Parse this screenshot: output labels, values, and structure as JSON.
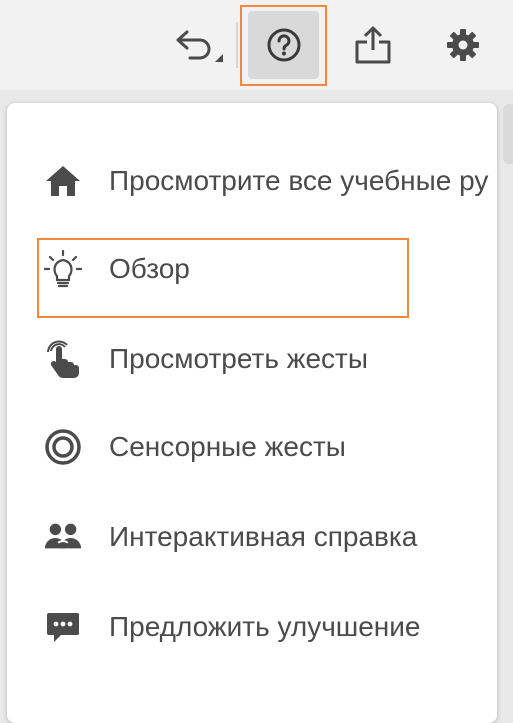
{
  "toolbar": {
    "undo_icon": "undo-icon",
    "help_icon": "help-icon",
    "share_icon": "share-icon",
    "settings_icon": "gear-icon"
  },
  "menu": {
    "items": [
      {
        "label": "Просмотрите все учебные ру",
        "icon": "home-icon"
      },
      {
        "label": "Обзор",
        "icon": "lightbulb-icon"
      },
      {
        "label": "Просмотреть жесты",
        "icon": "gesture-hand-icon"
      },
      {
        "label": "Сенсорные жесты",
        "icon": "touch-target-icon"
      },
      {
        "label": "Интерактивная справка",
        "icon": "community-icon"
      },
      {
        "label": "Предложить улучшение",
        "icon": "feedback-icon"
      }
    ]
  },
  "colors": {
    "highlight": "#f0883e",
    "icon": "#4b4b4b",
    "text": "#4b4b4b"
  }
}
